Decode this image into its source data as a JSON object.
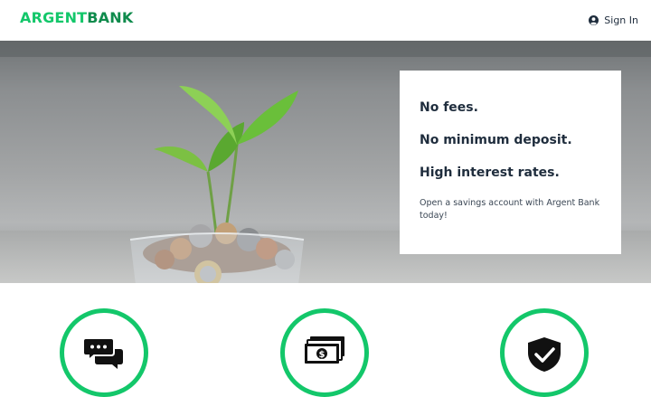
{
  "header": {
    "logo_part1": "ARGENT",
    "logo_part2": "BANK",
    "signin_label": "Sign In",
    "signin_icon": "user-circle-icon"
  },
  "hero": {
    "lines": [
      "No fees.",
      "No minimum deposit.",
      "High interest rates."
    ],
    "subtext": "Open a savings account with Argent Bank today!"
  },
  "features": [
    {
      "icon": "chat-icon"
    },
    {
      "icon": "money-icon"
    },
    {
      "icon": "shield-icon"
    }
  ],
  "colors": {
    "accent": "#13c76a",
    "accent_dark": "#0f8b4c",
    "text": "#1f2d3d"
  }
}
